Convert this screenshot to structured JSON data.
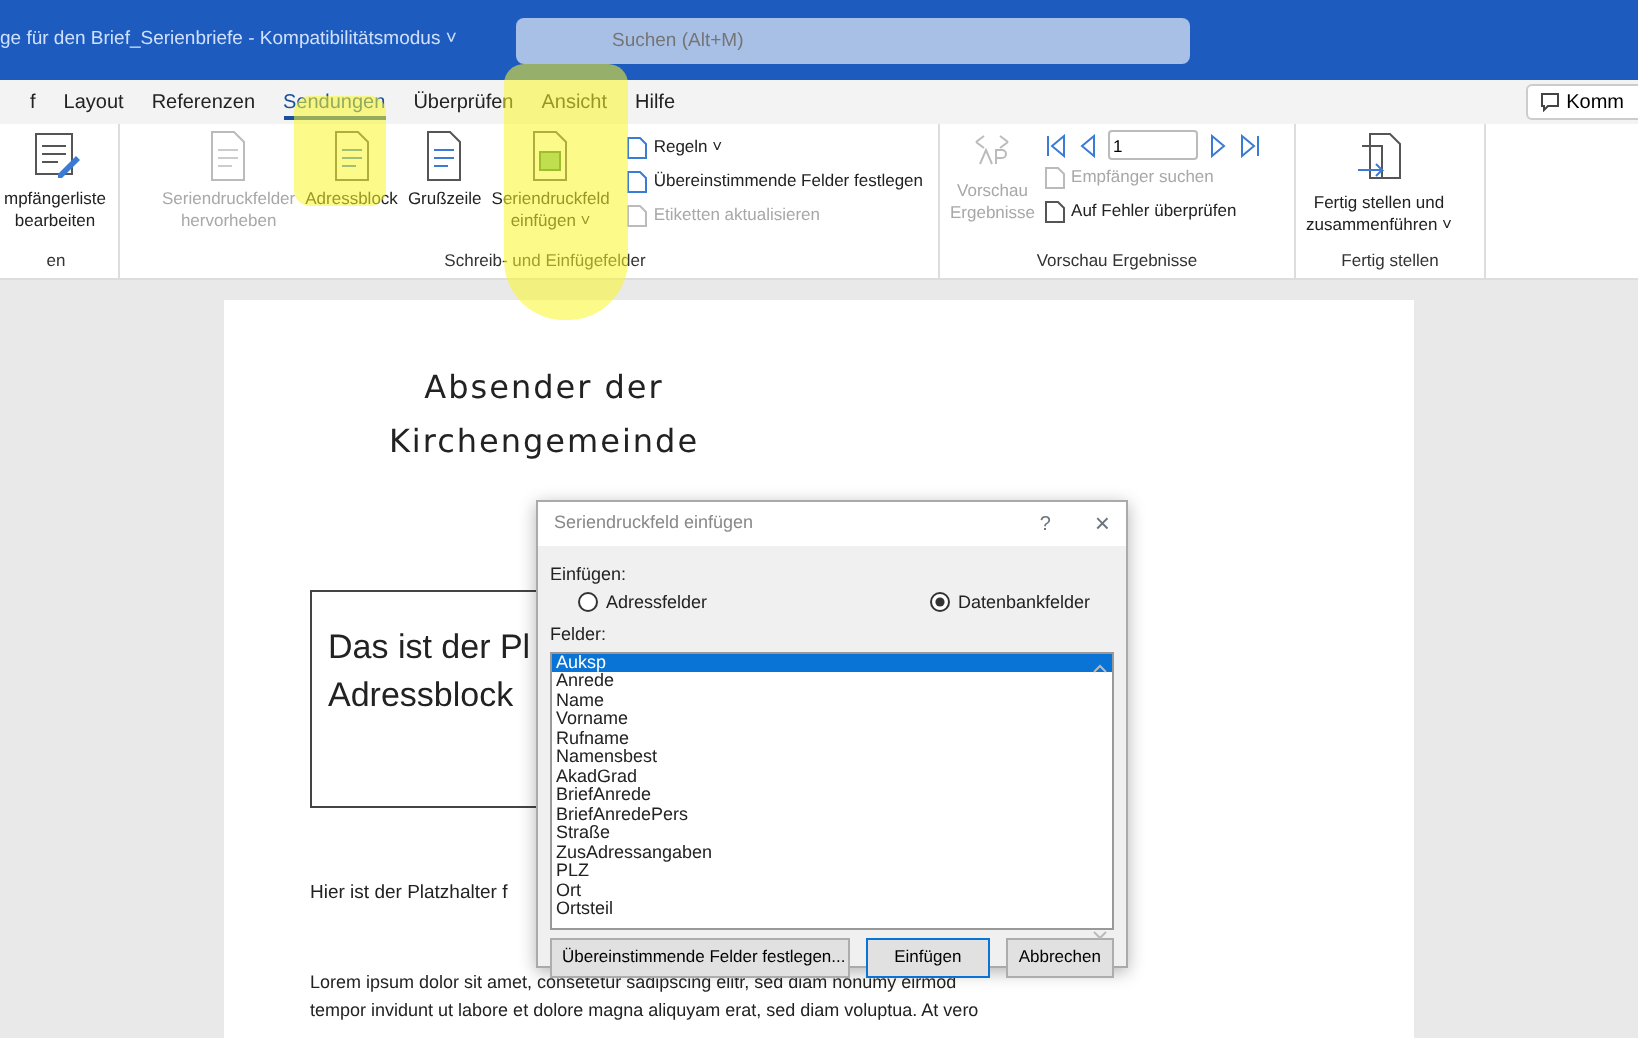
{
  "window": {
    "title": "ge für den Brief_Serienbriefe - Kompatibilitätsmodus ˅",
    "search_placeholder": "Suchen (Alt+M)"
  },
  "tabs": [
    {
      "label": "f",
      "selected": false
    },
    {
      "label": "Layout",
      "selected": false
    },
    {
      "label": "Referenzen",
      "selected": false
    },
    {
      "label": "Sendungen",
      "selected": true
    },
    {
      "label": "Überprüfen",
      "selected": false
    },
    {
      "label": "Ansicht",
      "selected": false
    },
    {
      "label": "Hilfe",
      "selected": false
    }
  ],
  "comment_button": "Komm",
  "ribbon": {
    "groups": [
      {
        "label": "en",
        "items": [
          {
            "kind": "large",
            "lines": [
              "mpfängerliste",
              "bearbeiten"
            ],
            "disabled": false
          }
        ]
      },
      {
        "label": "Schreib- und Einfügefelder",
        "items": [
          {
            "kind": "large",
            "lines": [
              "Seriendruckfelder",
              "hervorheben"
            ],
            "disabled": true
          },
          {
            "kind": "large",
            "lines": [
              "Adressblock"
            ],
            "disabled": false
          },
          {
            "kind": "large",
            "lines": [
              "Grußzeile"
            ],
            "disabled": false
          },
          {
            "kind": "large",
            "lines": [
              "Seriendruckfeld",
              "einfügen ˅"
            ],
            "disabled": false
          },
          {
            "kind": "stack",
            "rows": [
              {
                "label": "Regeln ˅",
                "disabled": false
              },
              {
                "label": "Übereinstimmende Felder festlegen",
                "disabled": false
              },
              {
                "label": "Etiketten aktualisieren",
                "disabled": true
              }
            ]
          }
        ]
      },
      {
        "label": "Vorschau Ergebnisse",
        "items": [
          {
            "kind": "large",
            "lines": [
              "Vorschau",
              "Ergebnisse"
            ],
            "disabled": true
          },
          {
            "kind": "nav",
            "record": "1",
            "rows": [
              {
                "label": "Empfänger suchen",
                "disabled": true
              },
              {
                "label": "Auf Fehler überprüfen",
                "disabled": false
              }
            ]
          }
        ]
      },
      {
        "label": "Fertig stellen",
        "items": [
          {
            "kind": "large",
            "lines": [
              "Fertig stellen und",
              "zusammenführen ˅"
            ],
            "disabled": false
          }
        ]
      }
    ]
  },
  "document": {
    "heading": [
      "Absender der",
      "Kirchengemeinde"
    ],
    "address_block": [
      "Das ist der Pl",
      "Adressblock"
    ],
    "placeholder_line": "Hier ist der Platzhalter f",
    "body": [
      "Lorem ipsum dolor sit amet, consetetur sadipscing elitr, sed diam nonumy eirmod",
      "tempor invidunt ut labore et dolore magna aliquyam erat, sed diam voluptua. At vero"
    ]
  },
  "dialog": {
    "title": "Seriendruckfeld einfügen",
    "help": "?",
    "close": "×",
    "insert_label": "Einfügen:",
    "options": [
      {
        "label": "Adressfelder",
        "selected": false
      },
      {
        "label": "Datenbankfelder",
        "selected": true
      }
    ],
    "fields_label": "Felder:",
    "fields": [
      {
        "label": "Auksp",
        "selected": true
      },
      {
        "label": "Anrede",
        "selected": false
      },
      {
        "label": "Name",
        "selected": false
      },
      {
        "label": "Vorname",
        "selected": false
      },
      {
        "label": "Rufname",
        "selected": false
      },
      {
        "label": "Namensbest",
        "selected": false
      },
      {
        "label": "AkadGrad",
        "selected": false
      },
      {
        "label": "BriefAnrede",
        "selected": false
      },
      {
        "label": "BriefAnredePers",
        "selected": false
      },
      {
        "label": "Straße",
        "selected": false
      },
      {
        "label": "ZusAdressangaben",
        "selected": false
      },
      {
        "label": "PLZ",
        "selected": false
      },
      {
        "label": "Ort",
        "selected": false
      },
      {
        "label": "Ortsteil",
        "selected": false
      }
    ],
    "buttons": [
      "Übereinstimmende Felder festlegen...",
      "Einfügen",
      "Abbrechen"
    ]
  }
}
